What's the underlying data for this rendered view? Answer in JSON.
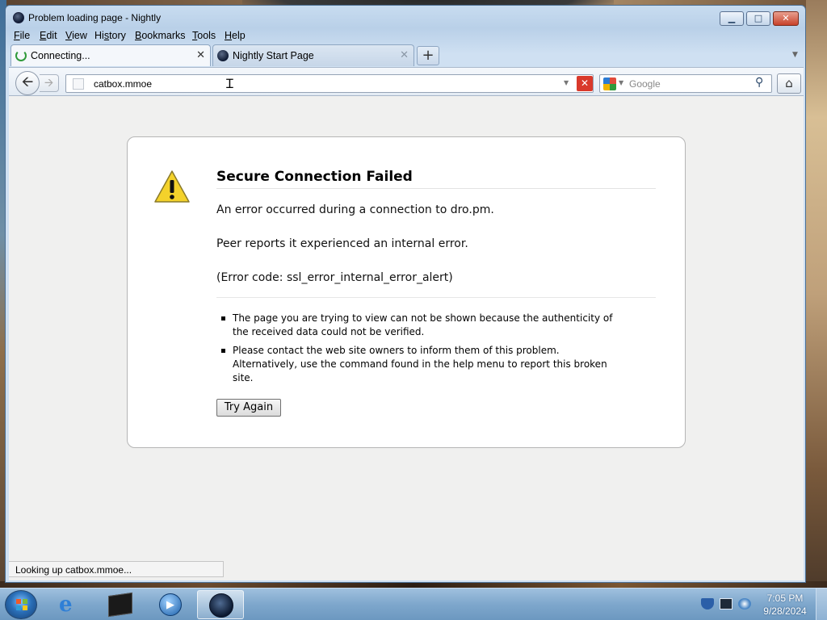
{
  "window": {
    "title": "Problem loading page - Nightly",
    "min_glyph": "▁",
    "max_glyph": "□",
    "close_glyph": "✕"
  },
  "menu": {
    "items": [
      {
        "accel": "F",
        "rest": "ile"
      },
      {
        "accel": "E",
        "rest": "dit"
      },
      {
        "accel": "V",
        "rest": "iew"
      },
      {
        "pre": "Hi",
        "accel": "s",
        "rest": "tory"
      },
      {
        "accel": "B",
        "rest": "ookmarks"
      },
      {
        "accel": "T",
        "rest": "ools"
      },
      {
        "accel": "H",
        "rest": "elp"
      }
    ]
  },
  "tabs": [
    {
      "label": "Connecting...",
      "active": true,
      "icon": "loading-spinner-icon"
    },
    {
      "label": "Nightly Start Page",
      "active": false,
      "icon": "nightly-globe-icon"
    }
  ],
  "tab_close_glyph": "✕",
  "new_tab_glyph": "+",
  "toolbar": {
    "back_glyph": "🡨",
    "forward_glyph": "🡪",
    "url": "catbox.mmoe",
    "stop_glyph": "✕",
    "search_placeholder": "Google",
    "search_glyph": "⚲",
    "home_glyph": "⌂",
    "dropdown_glyph": "▼"
  },
  "error": {
    "title": "Secure Connection Failed",
    "line1": "An error occurred during a connection to dro.pm.",
    "line2": "Peer reports it experienced an internal error.",
    "line3": "(Error code: ssl_error_internal_error_alert)",
    "bullets": [
      "The page you are trying to view can not be shown because the authenticity of the received data could not be verified.",
      "Please contact the web site owners to inform them of this problem. Alternatively, use the command found in the help menu to report this broken site."
    ],
    "button": "Try Again"
  },
  "status": {
    "text": "Looking up catbox.mmoe..."
  },
  "taskbar": {
    "items": [
      "start-button",
      "internet-explorer",
      "terminal",
      "media-player",
      "nightly"
    ],
    "media_glyph": "▶",
    "ie_glyph": "e",
    "time": "7:05 PM",
    "date": "9/28/2024"
  },
  "colors": {
    "stop_red": "#d9392b",
    "warning_yellow": "#f4d22b",
    "taskbar_blue": "#7ea7cc",
    "content_bg": "#f0f0ef"
  }
}
